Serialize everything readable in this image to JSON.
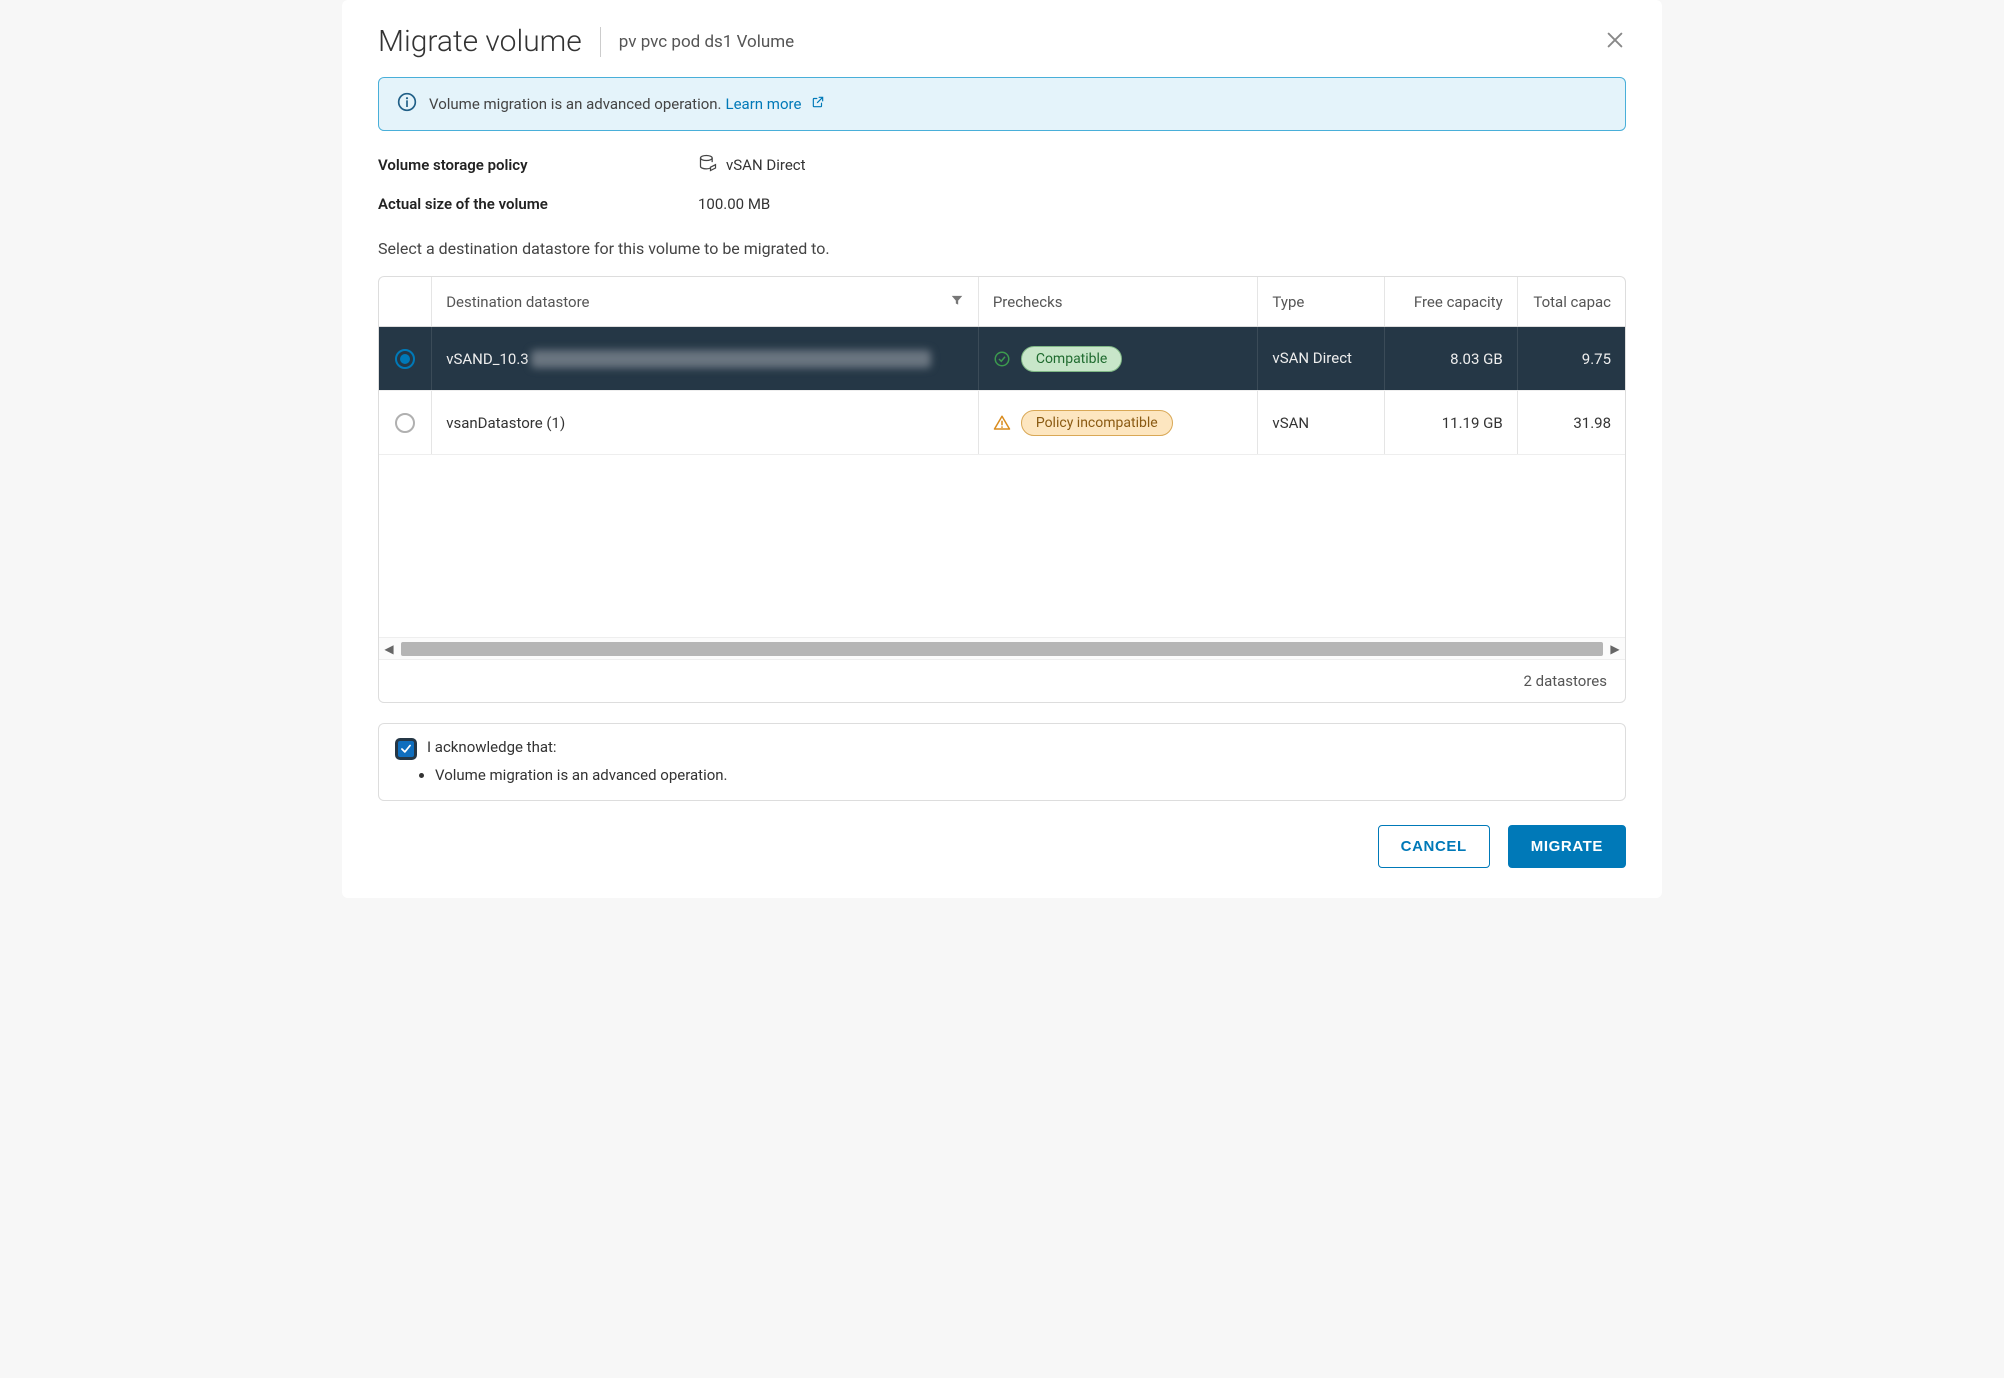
{
  "header": {
    "title": "Migrate volume",
    "subtitle": "pv pvc pod ds1 Volume"
  },
  "banner": {
    "text": "Volume migration is an advanced operation.",
    "link_label": "Learn more"
  },
  "details": {
    "policy_label": "Volume storage policy",
    "policy_value": "vSAN Direct",
    "size_label": "Actual size of the volume",
    "size_value": "100.00 MB"
  },
  "instruction": "Select a destination datastore for this volume to be migrated to.",
  "columns": {
    "dest": "Destination datastore",
    "pre": "Prechecks",
    "type": "Type",
    "free": "Free capacity",
    "total": "Total capac"
  },
  "rows": [
    {
      "selected": true,
      "name_prefix": "vSAND_10.3",
      "obscured": true,
      "precheck_label": "Compatible",
      "precheck_kind": "compat",
      "type": "vSAN Direct",
      "free": "8.03 GB",
      "total": "9.75 "
    },
    {
      "selected": false,
      "name_prefix": "vsanDatastore (1)",
      "obscured": false,
      "precheck_label": "Policy incompatible",
      "precheck_kind": "incompat",
      "type": "vSAN",
      "free": "11.19 GB",
      "total": "31.98 "
    }
  ],
  "footer_count": "2 datastores",
  "ack": {
    "lead": "I acknowledge that:",
    "items": [
      "Volume migration is an advanced operation."
    ]
  },
  "buttons": {
    "cancel": "CANCEL",
    "migrate": "MIGRATE"
  }
}
